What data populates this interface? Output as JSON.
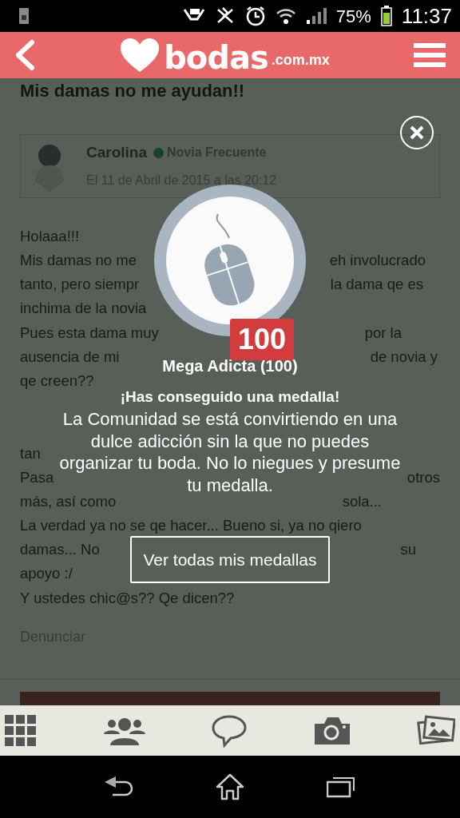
{
  "status_bar": {
    "battery_text": "75%",
    "time": "11:37"
  },
  "header": {
    "logo_main": "bodas",
    "logo_suffix": ".com.mx"
  },
  "thread_title": "Mis damas no me ayudan!!",
  "post": {
    "author": "Carolina",
    "online": true,
    "rank": "Novia Frecuente",
    "date": "El 11 de Abril de 2015 a las 20:12",
    "lines": [
      {
        "kind": "full",
        "text": "Holaaa!!!"
      },
      {
        "kind": "split",
        "left": "Mis damas no me",
        "right": "eh involucrado"
      },
      {
        "kind": "split",
        "left": "tanto, pero siempr",
        "right": "la dama qe es"
      },
      {
        "kind": "full",
        "text": "inchima de la novia"
      },
      {
        "kind": "split",
        "left": "Pues esta dama muy",
        "right": "por la"
      },
      {
        "kind": "split",
        "left": "ausencia de mi",
        "right": "de novia y"
      },
      {
        "kind": "full",
        "text": "qe creen??"
      },
      {
        "kind": "covered"
      },
      {
        "kind": "covered"
      },
      {
        "kind": "full",
        "text": "tan"
      },
      {
        "kind": "split",
        "left": "Pasa",
        "right": "otros"
      },
      {
        "kind": "split",
        "left": "más, así como",
        "right": "sola..."
      },
      {
        "kind": "full",
        "text": "La verdad ya no se qe hacer... Bueno si, ya no qiero"
      },
      {
        "kind": "split",
        "left": "damas... No",
        "right": "su"
      },
      {
        "kind": "full",
        "text": "apoyo :/"
      },
      {
        "kind": "full",
        "text": "Y ustedes chic@s?? Qe dicen??"
      }
    ],
    "report_link": "Denunciar"
  },
  "medal_popup": {
    "count": "100",
    "name": "Mega Adicta (100)",
    "headline": "¡Has conseguido una medalla!",
    "message": "La Comunidad se está convirtiendo en una dulce adicción sin la que no puedes organizar tu boda. No lo niegues y presume tu medalla.",
    "button": "Ver todas mis medallas"
  }
}
